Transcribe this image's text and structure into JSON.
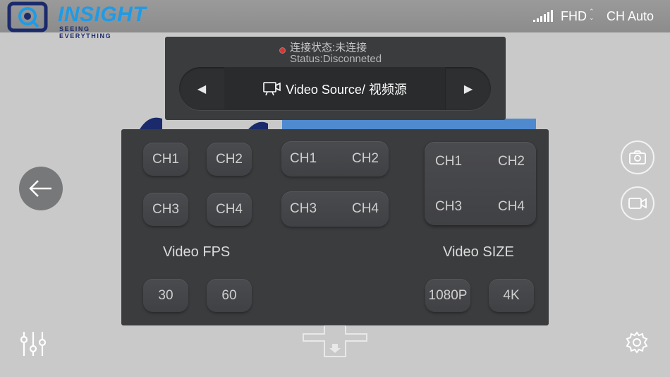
{
  "header": {
    "logo_text": "INSIGHT",
    "logo_tagline": "SEEING EVERYTHING",
    "resolution": "FHD",
    "channel_mode": "CH Auto",
    "icons": [
      "signal-icon",
      "resolution-arrows-icon"
    ]
  },
  "status": {
    "label_cn": "连接状态:未连接",
    "label_en": "Status:Disconneted",
    "indicator_color": "#d33333"
  },
  "video_source": {
    "label": "Video Source/ 视频源",
    "prev_icon": "left-triangle-icon",
    "next_icon": "right-triangle-icon",
    "icon": "video-source-icon"
  },
  "channels": {
    "single": [
      "CH1",
      "CH2",
      "CH3",
      "CH4"
    ],
    "pairs": [
      [
        "CH1",
        "CH2"
      ],
      [
        "CH3",
        "CH4"
      ]
    ],
    "quad": [
      "CH1",
      "CH2",
      "CH3",
      "CH4"
    ]
  },
  "fps": {
    "label": "Video FPS",
    "options": [
      "30",
      "60"
    ]
  },
  "size": {
    "label": "Video SIZE",
    "options": [
      "1080P",
      "4K"
    ]
  },
  "controls": {
    "back_icon": "arrow-left-icon",
    "photo_icon": "camera-icon",
    "record_icon": "video-camera-icon",
    "sliders_icon": "sliders-icon",
    "settings_icon": "gear-icon",
    "dpad_icon": "dpad-icon"
  },
  "colors": {
    "accent": "#1e9be6",
    "panel": "#3b3c3e",
    "background": "#c9c9c9"
  }
}
